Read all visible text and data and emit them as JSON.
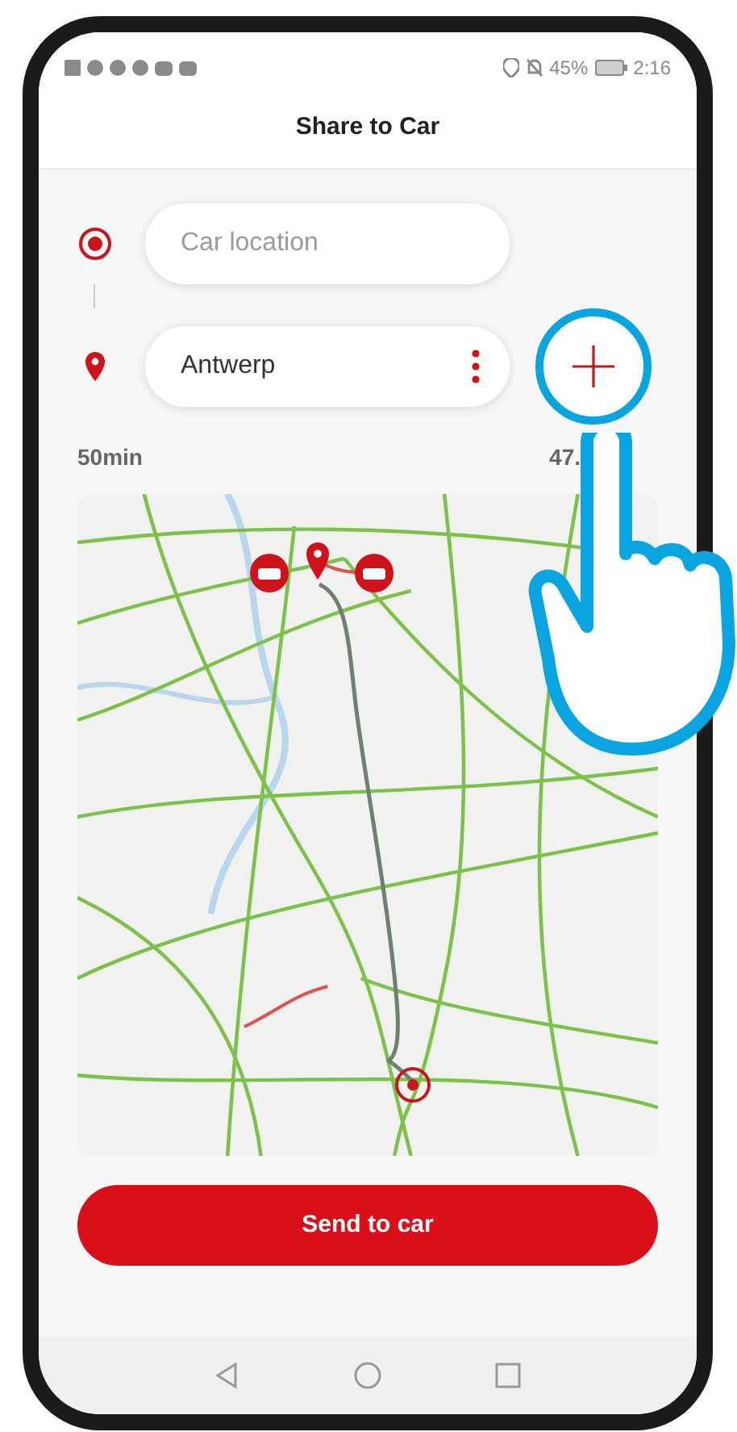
{
  "status_bar": {
    "battery": "45%",
    "time": "2:16"
  },
  "header": {
    "title": "Share to Car"
  },
  "route": {
    "origin": {
      "placeholder": "Car location"
    },
    "destination": {
      "value": "Antwerp"
    }
  },
  "summary": {
    "duration": "50min",
    "distance": "47."
  },
  "send_button": "Send to car"
}
